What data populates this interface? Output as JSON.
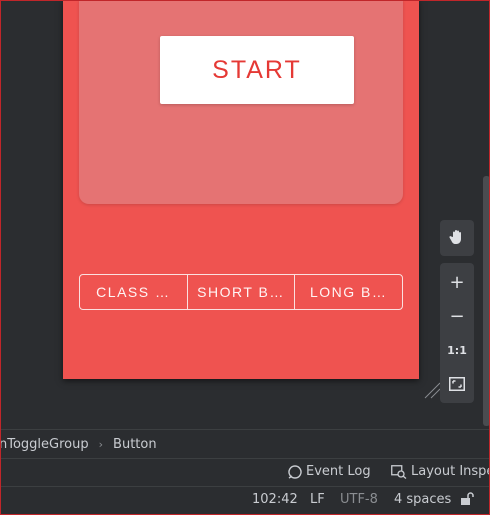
{
  "device": {
    "start_label": "START",
    "toggles": [
      "CLASS …",
      "SHORT B…",
      "LONG B…"
    ]
  },
  "zoom": {
    "pan_icon": "hand-icon",
    "zoom_in": "+",
    "zoom_out": "−",
    "actual_size": "1:1",
    "fit_icon": "fit-screen-icon"
  },
  "breadcrumb": {
    "items": [
      "nToggleGroup",
      "Button"
    ]
  },
  "toolwindows": {
    "event_log": "Event Log",
    "layout_inspector": "Layout Inspec"
  },
  "status": {
    "position": "102:42",
    "line_ending": "LF",
    "encoding": "UTF-8",
    "indent": "4 spaces"
  },
  "colors": {
    "device_bg": "#ef5350",
    "card_bg": "#e57373",
    "accent": "#e53935",
    "ide_bg": "#2b2d30"
  }
}
